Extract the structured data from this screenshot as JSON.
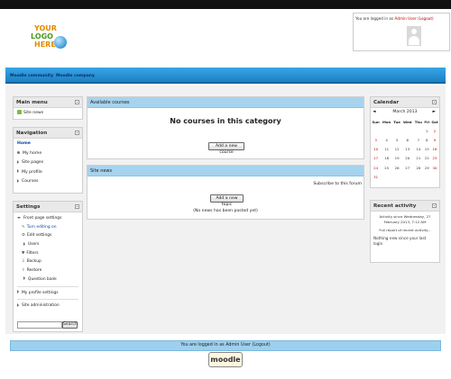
{
  "header": {
    "logo": {
      "line1": "YOUR",
      "line2": "LOGO",
      "line3": "HERE"
    },
    "login_prefix": "You are logged in as ",
    "login_user": "Admin User",
    "login_logout": "(Logout)"
  },
  "navbar": {
    "items": [
      "Moodle community",
      "Moodle company"
    ]
  },
  "main_menu": {
    "title": "Main menu",
    "items": [
      "Site news"
    ]
  },
  "navigation": {
    "title": "Navigation",
    "home": "Home",
    "items": [
      "My home",
      "Site pages",
      "My profile",
      "Courses"
    ]
  },
  "settings": {
    "title": "Settings",
    "front_page": "Front page settings",
    "sub_items": [
      "Turn editing on",
      "Edit settings",
      "Users",
      "Filters",
      "Backup",
      "Restore",
      "Question bank"
    ],
    "my_profile": "My profile settings",
    "site_admin": "Site administration",
    "search_button": "Search",
    "search_value": ""
  },
  "available_courses": {
    "title": "Available courses",
    "message": "No courses in this category",
    "add_button": "Add a new course"
  },
  "site_news": {
    "title": "Site news",
    "subscribe": "Subscribe to this forum",
    "add_button": "Add a new topic",
    "empty": "(No news has been posted yet)"
  },
  "calendar": {
    "title": "Calendar",
    "month": "March 2013",
    "prev": "◄",
    "next": "►",
    "day_headers": [
      "Sun",
      "Mon",
      "Tue",
      "Wed",
      "Thu",
      "Fri",
      "Sat"
    ],
    "weeks": [
      [
        "",
        "",
        "",
        "",
        "",
        "1",
        "2"
      ],
      [
        "3",
        "4",
        "5",
        "6",
        "7",
        "8",
        "9"
      ],
      [
        "10",
        "11",
        "12",
        "13",
        "14",
        "15",
        "16"
      ],
      [
        "17",
        "18",
        "19",
        "20",
        "21",
        "22",
        "23"
      ],
      [
        "24",
        "25",
        "26",
        "27",
        "28",
        "29",
        "30"
      ],
      [
        "31",
        "",
        "",
        "",
        "",
        "",
        ""
      ]
    ]
  },
  "recent_activity": {
    "title": "Recent activity",
    "since_line1": "Activity since Wednesday, 27",
    "since_line2": "February 2013, 7:12 AM",
    "full_report": "Full report of recent activity...",
    "nothing_line1": "Nothing new since your last",
    "nothing_line2": "login"
  },
  "footer": {
    "login_prefix": "You are logged in as ",
    "login_user": "Admin User",
    "login_logout": "(Logout)",
    "logo_text": "moodle"
  },
  "colors": {
    "navbar": "#1d7fc4",
    "center_header": "#a6d3ee",
    "footer_bar": "#9ed0ee",
    "weekend": "#bb0000"
  }
}
